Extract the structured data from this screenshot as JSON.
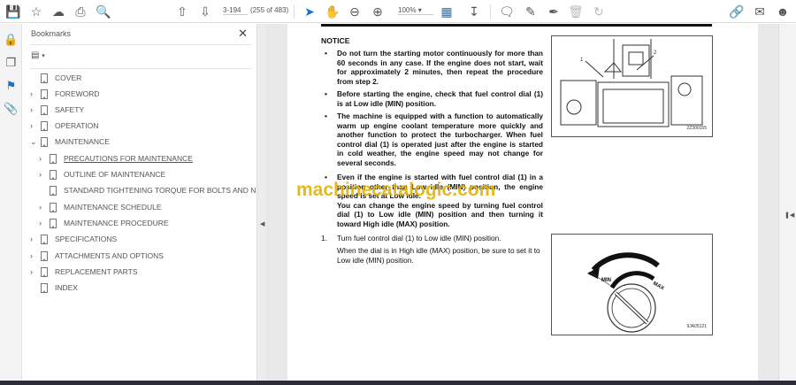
{
  "toolbar": {
    "page_input": "3-194",
    "page_count": "(255 of 483)",
    "zoom": "100%"
  },
  "bookmarks": {
    "title": "Bookmarks",
    "items": [
      {
        "label": "COVER"
      },
      {
        "label": "FOREWORD"
      },
      {
        "label": "SAFETY"
      },
      {
        "label": "OPERATION"
      },
      {
        "label": "MAINTENANCE"
      },
      {
        "label": "PRECAUTIONS FOR MAINTENANCE"
      },
      {
        "label": "OUTLINE OF MAINTENANCE"
      },
      {
        "label": "STANDARD TIGHTENING TORQUE FOR BOLTS AND NUTS"
      },
      {
        "label": "MAINTENANCE SCHEDULE"
      },
      {
        "label": "MAINTENANCE PROCEDURE"
      },
      {
        "label": "SPECIFICATIONS"
      },
      {
        "label": "ATTACHMENTS AND OPTIONS"
      },
      {
        "label": "REPLACEMENT PARTS"
      },
      {
        "label": "INDEX"
      }
    ]
  },
  "doc": {
    "notice_title": "NOTICE",
    "bullets": [
      "Do not turn the starting motor continuously for more than 60 seconds in any case. If the engine does not start, wait for approximately 2 minutes, then repeat the procedure from step 2.",
      "Before starting the engine, check that fuel control dial (1) is at Low idle (MIN) position.",
      "The machine is equipped with a function to automatically warm up engine coolant temperature more quickly and another function to protect the turbocharger. When fuel control dial (1) is operated just after the engine is started in cold weather, the engine speed may not change for several seconds.",
      "Even if the engine is started with fuel control dial (1) in a position other than Low idle (MIN) position, the engine speed is set at Low idle."
    ],
    "bullet4_extra": "You can change the engine speed by turning fuel control dial (1) to Low idle (MIN) position and then turning it toward High idle (MAX) position.",
    "step_num": "1.",
    "step_text": "Turn fuel control dial (1) to Low idle (MIN) position.",
    "step_note": "When the dial is in High idle (MAX) position, be sure to set it to Low idle (MIN) position.",
    "fig1": {
      "label1": "1",
      "label2": "2",
      "caption": "2Z300155"
    },
    "fig2": {
      "min": "MIN",
      "max": "MAX",
      "caption": "9JA05121"
    },
    "watermark": "machinecatalogic.com"
  }
}
